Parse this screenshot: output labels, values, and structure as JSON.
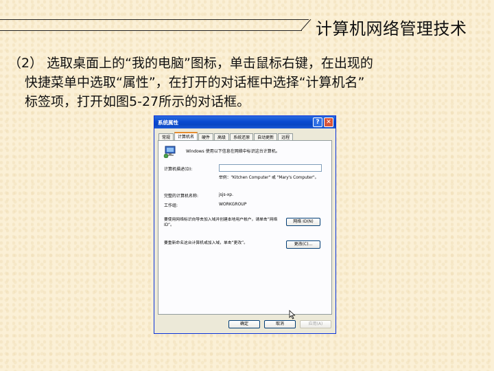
{
  "header": {
    "title": "计算机网络管理技术"
  },
  "paragraph": {
    "line1": "（2） 选取桌面上的“我的电脑”图标，单击鼠标右键，在出现的",
    "line2": "快捷菜单中选取“属性”，在打开的对话框中选择“计算机名”",
    "line3": "标签项，打开如图5-27所示的对话框。"
  },
  "dialog": {
    "title": "系统属性",
    "help_label": "?",
    "close_label": "✕",
    "tabs": [
      "常规",
      "计算机名",
      "硬件",
      "高级",
      "系统还原",
      "自动更新",
      "远程"
    ],
    "description": "Windows 使用以下信息在网络中标识这台计算机。",
    "computer_desc_label": "计算机描述(D):",
    "computer_desc_value": "",
    "example_text": "举例：\"Kitchen Computer\" 或 \"Mary's Computer\"。",
    "full_name_label": "完整的计算机名称:",
    "full_name_value": "jsjs-xp.",
    "workgroup_label": "工作组:",
    "workgroup_value": "WORKGROUP",
    "network_id_text": "要使用网络标识向导去加入域并创建本地用户帐户，请单击“网络 ID”。",
    "network_id_button": "网络 ID(N)",
    "change_text": "要重新命名这台计算机或加入域，单击“更改”。",
    "change_button": "更改(C)...",
    "ok_button": "确定",
    "cancel_button": "取消",
    "apply_button": "应用(A)"
  }
}
